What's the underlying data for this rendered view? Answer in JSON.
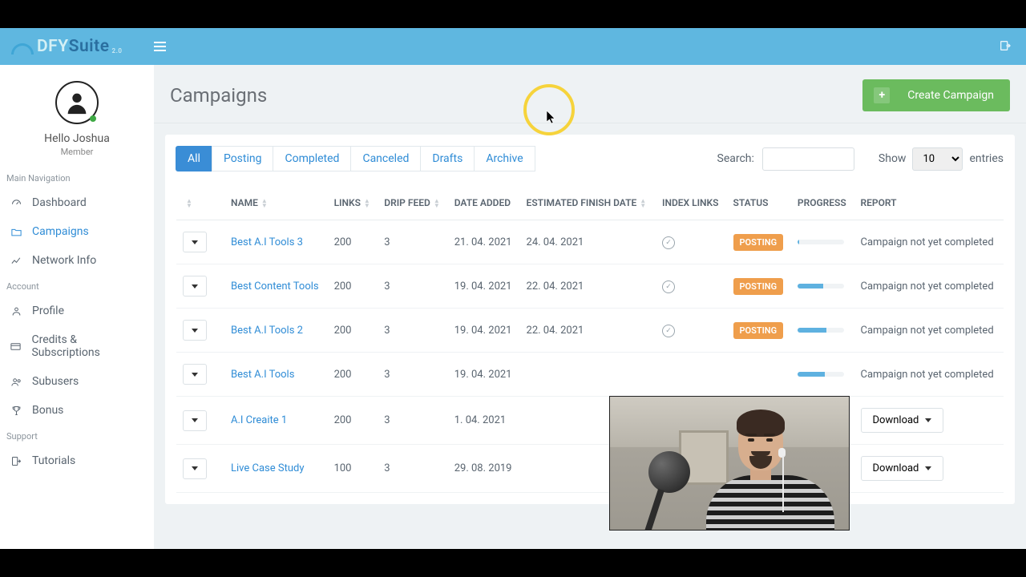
{
  "brand": {
    "prefix": "DFY",
    "suffix": "Suite",
    "version": "2.0"
  },
  "profile": {
    "greeting": "Hello Joshua",
    "role": "Member"
  },
  "nav": {
    "section_main": "Main Navigation",
    "section_account": "Account",
    "section_support": "Support",
    "items": {
      "dashboard": "Dashboard",
      "campaigns": "Campaigns",
      "network_info": "Network Info",
      "profile": "Profile",
      "credits": "Credits & Subscriptions",
      "subusers": "Subusers",
      "bonus": "Bonus",
      "tutorials": "Tutorials"
    }
  },
  "page": {
    "title": "Campaigns",
    "create_btn": "Create Campaign"
  },
  "filters": {
    "tabs": {
      "all": "All",
      "posting": "Posting",
      "completed": "Completed",
      "canceled": "Canceled",
      "drafts": "Drafts",
      "archive": "Archive"
    },
    "search_label": "Search:",
    "show_label": "Show",
    "entries_label": "entries",
    "show_value": "10"
  },
  "table": {
    "headers": {
      "name": "NAME",
      "links": "LINKS",
      "drip": "DRIP FEED",
      "date_added": "DATE ADDED",
      "est_finish": "ESTIMATED FINISH DATE",
      "index_links": "INDEX LINKS",
      "status": "STATUS",
      "progress": "PROGRESS",
      "report": "REPORT"
    },
    "rows": [
      {
        "name": "Best A.I Tools 3",
        "links": "200",
        "drip": "3",
        "date_added": "21. 04. 2021",
        "est_finish": "24. 04. 2021",
        "index": true,
        "status": "POSTING",
        "progress": 3,
        "report": "Campaign not yet completed"
      },
      {
        "name": "Best Content Tools",
        "links": "200",
        "drip": "3",
        "date_added": "19. 04. 2021",
        "est_finish": "22. 04. 2021",
        "index": true,
        "status": "POSTING",
        "progress": 55,
        "report": "Campaign not yet completed"
      },
      {
        "name": "Best A.I Tools 2",
        "links": "200",
        "drip": "3",
        "date_added": "19. 04. 2021",
        "est_finish": "22. 04. 2021",
        "index": true,
        "status": "POSTING",
        "progress": 62,
        "report": "Campaign not yet completed"
      },
      {
        "name": "Best A.I Tools",
        "links": "200",
        "drip": "3",
        "date_added": "19. 04. 2021",
        "est_finish": "",
        "index": false,
        "status": "",
        "progress": 58,
        "report": "Campaign not yet completed"
      },
      {
        "name": "A.I Creaite 1",
        "links": "200",
        "drip": "3",
        "date_added": "1. 04. 2021",
        "est_finish": "",
        "index": false,
        "status": "",
        "progress": null,
        "report_action": "Download"
      },
      {
        "name": "Live Case Study",
        "links": "100",
        "drip": "3",
        "date_added": "29. 08. 2019",
        "est_finish": "",
        "index": false,
        "status": "",
        "progress": null,
        "report_action": "Download"
      }
    ]
  }
}
